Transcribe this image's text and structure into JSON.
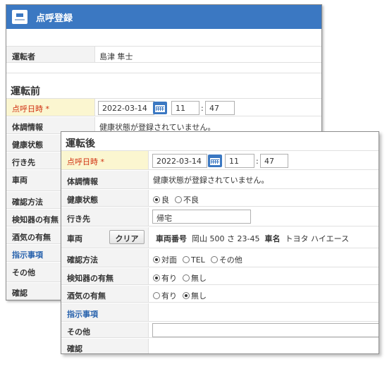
{
  "back": {
    "title": "点呼登録",
    "driver_label": "運転者",
    "driver_name": "島津 隼士",
    "section": "運転前",
    "rollcall_label": "点呼日時 *",
    "date": "2022-03-14",
    "hour": "11",
    "minute": "47",
    "colon": ":",
    "health_info_label": "体調情報",
    "health_info_text": "健康状態が登録されていません。",
    "labels": {
      "health": "健康状態",
      "dest": "行き先",
      "vehicle": "車両",
      "confirm": "確認方法",
      "detector": "検知器の有無",
      "alcohol": "酒気の有無",
      "instruction": "指示事項",
      "other": "その他",
      "check": "確認"
    }
  },
  "front": {
    "section": "運転後",
    "rollcall_label": "点呼日時 *",
    "date": "2022-03-14",
    "hour": "11",
    "minute": "47",
    "colon": ":",
    "health_info_label": "体調情報",
    "health_info_text": "健康状態が登録されていません。",
    "health_label": "健康状態",
    "health_options": [
      "良",
      "不良"
    ],
    "health_selected": "良",
    "dest_label": "行き先",
    "dest_value": "帰宅",
    "vehicle_label": "車両",
    "clear_button": "クリア",
    "vehicle_no_label": "車両番号",
    "vehicle_no": "岡山 500 さ 23-45",
    "vehicle_name_label": "車名",
    "vehicle_name": "トヨタ ハイエース",
    "confirm_label": "確認方法",
    "confirm_options": [
      "対面",
      "TEL",
      "その他"
    ],
    "confirm_selected": "対面",
    "detector_label": "検知器の有無",
    "detector_options": [
      "有り",
      "無し"
    ],
    "detector_selected": "有り",
    "alcohol_label": "酒気の有無",
    "alcohol_options": [
      "有り",
      "無し"
    ],
    "alcohol_selected": "無し",
    "instruction_label": "指示事項",
    "other_label": "その他",
    "other_value": "",
    "check_label": "確認"
  }
}
